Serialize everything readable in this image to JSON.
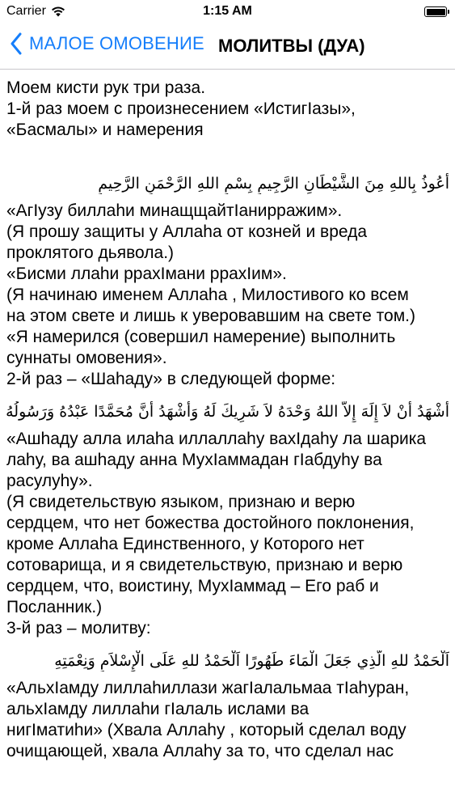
{
  "status_bar": {
    "carrier": "Carrier",
    "time": "1:15 AM"
  },
  "nav": {
    "back_label": "МАЛОЕ ОМОВЕНИЕ",
    "title": "МОЛИТВЫ (ДУА)"
  },
  "content": {
    "lines": [
      "Моем кисти рук три раза.",
      "1-й раз моем с произнесением «ИстигIазы»,",
      "«Басмалы» и намерения",
      "",
      "أَعُوذُ بِاللهِ مِنَ الشَّيْطَانِ الرَّجِيمِ  بِسْمِ اللهِ الرَّحْمَنِ الرَّحِيمِ",
      "«АгIузу биллаhи минащщайтIанирражим».",
      "(Я прошу защиты у Аллаhа от козней и вреда",
      "проклятого дьявола.)",
      "«Бисми ллаhи ррахIмани ррахIим».",
      "(Я начинаю именем Аллаhа , Милостивого ко всем",
      "на этом свете и лишь к уверовавшим на свете том.)",
      " «Я намерился (совершил намерение) выполнить",
      "суннаты омовения».",
      "2-й раз – «Шаhаду» в следующей форме:",
      "أَشْهَدُ أَنْ لاَ إِلَهَ إِلاَّ اللهُ وَحْدَهُ لاَ شَرِيكَ لَهُ وَأَشْهَدُ أَنَّ مُحَمَّدًا عَبْدُهُ وَرَسُولُهُ",
      "«Ашhаду алла илаhа иллаллаhу вахIдаhу ла шарика",
      "лаhу, ва ашhаду анна МухIаммадан гIабдуhу ва",
      "расулуhу».",
      "(Я свидетельствую языком, признаю и верю",
      "сердцем, что нет божества достойного поклонения,",
      "кроме Аллаhа  Единственного, у Которого нет",
      "сотоварища, и я свидетельствую, признаю и верю",
      "сердцем, что, воистину, МухIаммад  – Его раб и",
      "Посланник.)",
      "3-й раз – молитву:",
      "اَلْحَمْدُ للهِ الَّذِي جَعَلَ الْمَاءَ طَهُورًا اَلْحَمْدُ للهِ عَلَى الْإِسْلاَمِ وَنِعْمَتِهِ",
      "«АльхIамду лиллаhиллази жагIалальмаа тIаhуран,",
      "альхIамду лиллаhи гIалаль ислами ва",
      "нигIматиhи» (Хвала Аллаhу , который сделал воду",
      "очищающей, хвала Аллаhу  за то, что сделал нас"
    ]
  }
}
